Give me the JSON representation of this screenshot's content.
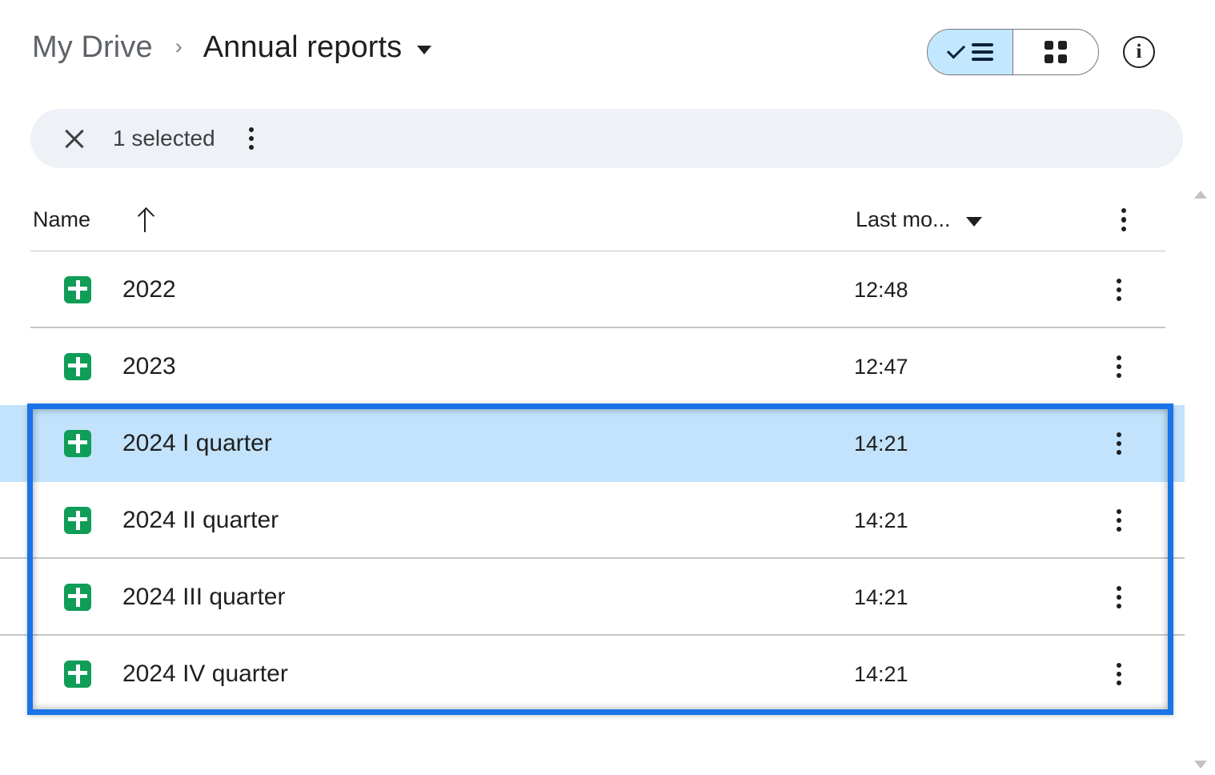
{
  "header": {
    "breadcrumb": {
      "root": "My Drive",
      "separator": "›",
      "current": "Annual reports"
    },
    "view_toggle": {
      "list_label": "List view",
      "grid_label": "Grid view",
      "selected": "list"
    },
    "info_label": "i"
  },
  "selection_bar": {
    "close_label": "Close",
    "count_text": "1 selected",
    "more_label": "More actions"
  },
  "table": {
    "columns": {
      "name": "Name",
      "modified": "Last mo...",
      "sort_direction": "ascending"
    },
    "rows": [
      {
        "name": "2022",
        "modified": "12:48",
        "icon": "google-sheets-icon",
        "selected": false
      },
      {
        "name": "2023",
        "modified": "12:47",
        "icon": "google-sheets-icon",
        "selected": false
      },
      {
        "name": "2024 I quarter",
        "modified": "14:21",
        "icon": "google-sheets-icon",
        "selected": true
      },
      {
        "name": "2024 II quarter",
        "modified": "14:21",
        "icon": "google-sheets-icon",
        "selected": false
      },
      {
        "name": "2024 III quarter",
        "modified": "14:21",
        "icon": "google-sheets-icon",
        "selected": false
      },
      {
        "name": "2024 IV quarter",
        "modified": "14:21",
        "icon": "google-sheets-icon",
        "selected": false
      }
    ]
  },
  "colors": {
    "accent_blue": "#1a73e8",
    "selected_row": "#c2e3fb",
    "toggle_selected": "#c2e7ff",
    "selection_bar_bg": "#eef1f6",
    "sheets_green": "#0f9d58",
    "divider": "#c4c7c5"
  }
}
